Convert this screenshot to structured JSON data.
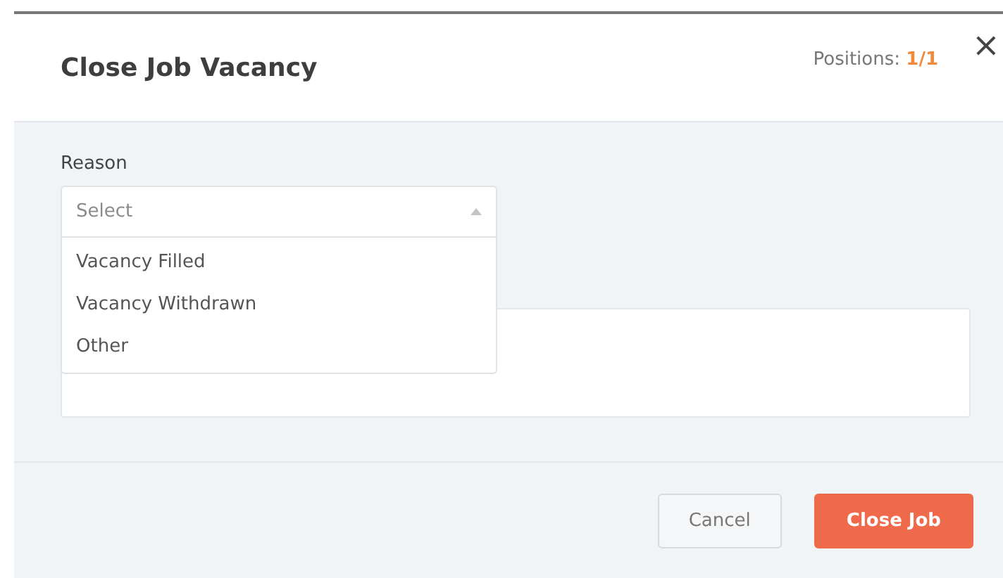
{
  "dialog": {
    "title": "Close Job Vacancy",
    "positions_label": "Positions:",
    "positions_value": "1/1",
    "close_glyph": "×"
  },
  "reason": {
    "label": "Reason",
    "placeholder": "Select",
    "expanded": true,
    "options": [
      {
        "label": "Vacancy Filled",
        "selected": false
      },
      {
        "label": "Vacancy Withdrawn",
        "selected": false
      },
      {
        "label": "Other",
        "selected": false
      }
    ]
  },
  "buttons": [
    {
      "label": "Cancel",
      "kind": "secondary"
    },
    {
      "label": "Close Job",
      "kind": "primary"
    }
  ]
}
